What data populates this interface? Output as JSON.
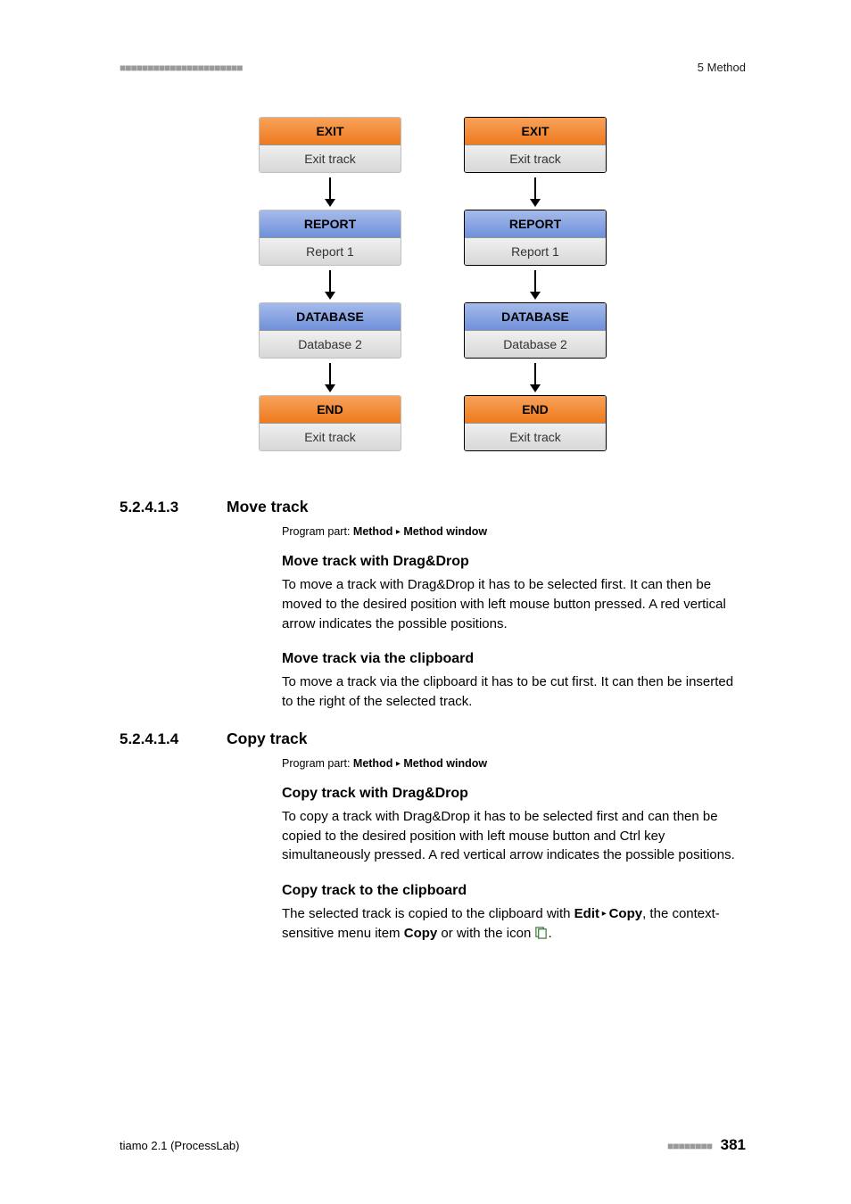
{
  "header": {
    "dots_left": "■■■■■■■■■■■■■■■■■■■■■■",
    "breadcrumb": "5 Method"
  },
  "diagram": {
    "left": [
      {
        "head": "EXIT",
        "body": "Exit track",
        "cls": "orange"
      },
      {
        "head": "REPORT",
        "body": "Report 1",
        "cls": "blue"
      },
      {
        "head": "DATABASE",
        "body": "Database 2",
        "cls": "blue"
      },
      {
        "head": "END",
        "body": "Exit track",
        "cls": "orange"
      }
    ],
    "right": [
      {
        "head": "EXIT",
        "body": "Exit track",
        "cls": "orange"
      },
      {
        "head": "REPORT",
        "body": "Report 1",
        "cls": "blue"
      },
      {
        "head": "DATABASE",
        "body": "Database 2",
        "cls": "blue"
      },
      {
        "head": "END",
        "body": "Exit track",
        "cls": "orange"
      }
    ]
  },
  "sec1": {
    "num": "5.2.4.1.3",
    "title": "Move track",
    "program_label": "Program part:",
    "program_path1": "Method",
    "program_sep": "▸",
    "program_path2": "Method window",
    "h1": "Move track with Drag&Drop",
    "p1": "To move a track with Drag&Drop it has to be selected first. It can then be moved to the desired position with left mouse button pressed. A red vertical arrow indicates the possible positions.",
    "h2": "Move track via the clipboard",
    "p2": "To move a track via the clipboard it has to be cut first. It can then be inserted to the right of the selected track."
  },
  "sec2": {
    "num": "5.2.4.1.4",
    "title": "Copy track",
    "program_label": "Program part:",
    "program_path1": "Method",
    "program_sep": "▸",
    "program_path2": "Method window",
    "h1": "Copy track with Drag&Drop",
    "p1": "To copy a track with Drag&Drop it has to be selected first and can then be copied to the desired position with left mouse button and Ctrl key simultaneously pressed. A red vertical arrow indicates the possible positions.",
    "h2": "Copy track to the clipboard",
    "p2a": "The selected track is copied to the clipboard with ",
    "p2_edit": "Edit",
    "p2_sep": " ▸ ",
    "p2_copy": "Copy",
    "p2b": ", the context-sensitive menu item ",
    "p2_copy2": "Copy",
    "p2c": " or with the icon ",
    "p2d": "."
  },
  "footer": {
    "left": "tiamo 2.1 (ProcessLab)",
    "dots": "■■■■■■■■",
    "page": "381"
  }
}
